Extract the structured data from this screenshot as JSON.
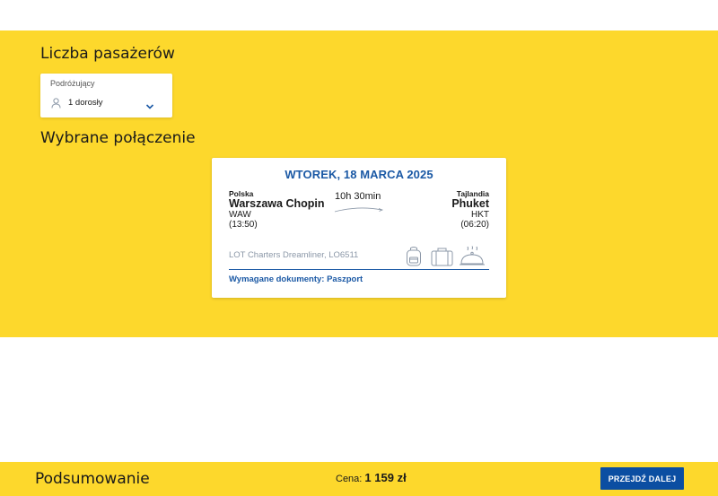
{
  "passengers": {
    "title": "Liczba pasażerów",
    "field_label": "Podróżujący",
    "field_value": "1 dorosły"
  },
  "connection": {
    "title": "Wybrane połączenie",
    "date": "WTOREK, 18 MARCA 2025",
    "from": {
      "country": "Polska",
      "city": "Warszawa Chopin",
      "code": "WAW",
      "time": "(13:50)"
    },
    "to": {
      "country": "Tajlandia",
      "city": "Phuket",
      "code": "HKT",
      "time": "(06:20)"
    },
    "duration": "10h 30min",
    "flight_info": "LOT Charters Dreamliner, LO6511",
    "documents": "Wymagane dokumenty: Paszport",
    "icons": [
      "backpack-icon",
      "suitcase-icon",
      "meal-icon"
    ]
  },
  "footer": {
    "summary": "Podsumowanie",
    "price_label": "Cena:",
    "price_value": "1 159 zł",
    "next_button": "PRZEJDŹ DALEJ"
  },
  "colors": {
    "yellow": "#fdd82c",
    "brand_blue": "#1b59a5",
    "button_blue": "#0b4ea2"
  }
}
